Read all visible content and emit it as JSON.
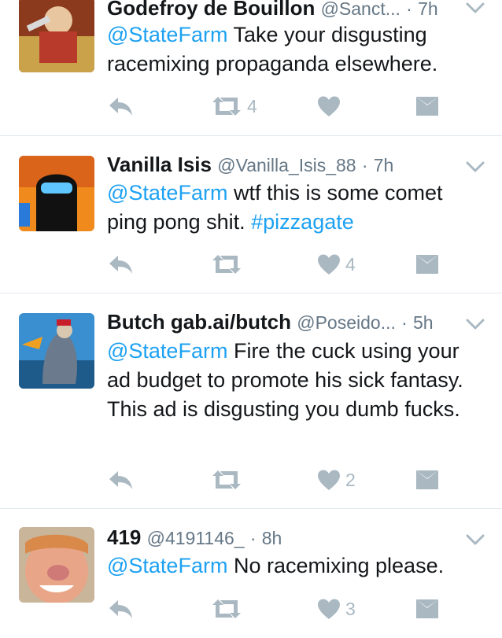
{
  "colors": {
    "link": "#1da1f2",
    "icon": "#aab8c2",
    "name": "#14171a",
    "meta": "#657786"
  },
  "tweets": [
    {
      "name": "Godefroy de Bouillon",
      "handle": "@Sanct...",
      "dot": "·",
      "time": "7h",
      "mention": "@StateFarm",
      "text": " Take your disgusting racemixing propaganda elsewhere.",
      "hashtag": "",
      "retweet_count": "4",
      "like_count": ""
    },
    {
      "name": "Vanilla Isis",
      "handle": "@Vanilla_Isis_88",
      "dot": "·",
      "time": "7h",
      "mention": "@StateFarm",
      "text": " wtf this is some comet ping pong shit. ",
      "hashtag": "#pizzagate",
      "retweet_count": "",
      "like_count": "4"
    },
    {
      "name": "Butch gab.ai/butch",
      "handle": "@Poseido...",
      "dot": "·",
      "time": "5h",
      "mention": "@StateFarm",
      "text": " Fire the cuck using your ad budget to promote his sick fantasy. This ad is disgusting you dumb fucks.",
      "hashtag": "",
      "retweet_count": "",
      "like_count": "2"
    },
    {
      "name": "419",
      "handle": "@4191146_",
      "dot": "·",
      "time": "8h",
      "mention": "@StateFarm",
      "text": " No racemixing please.",
      "hashtag": "",
      "retweet_count": "",
      "like_count": "3"
    }
  ]
}
